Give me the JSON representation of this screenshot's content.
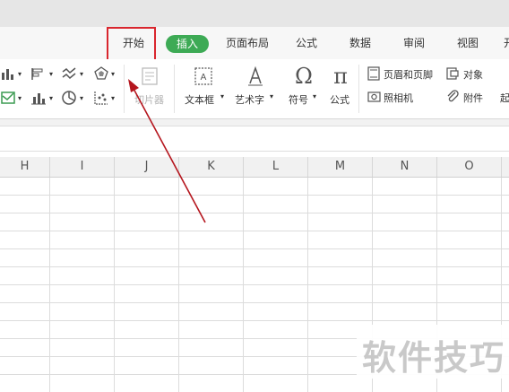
{
  "ribbon_tabs": {
    "start": "开始",
    "insert": "插入",
    "page_layout": "页面布局",
    "formula": "公式",
    "data": "数据",
    "review": "审阅",
    "view": "视图",
    "cut_off": "开"
  },
  "ribbon": {
    "clipboard_label": "切片器",
    "textbox_label": "文本框",
    "wordart_label": "艺术字",
    "symbol_label": "符号",
    "equation_label": "公式",
    "header_footer_label": "页眉和页脚",
    "object_label": "对象",
    "camera_label": "照相机",
    "attachment_label": "附件",
    "more_label": "起"
  },
  "columns": [
    "H",
    "I",
    "J",
    "K",
    "L",
    "M",
    "N",
    "O"
  ],
  "watermark": "软件技巧",
  "colors": {
    "active_tab": "#3daa55",
    "highlight_box": "#d9262e",
    "arrow": "#b5161e"
  }
}
